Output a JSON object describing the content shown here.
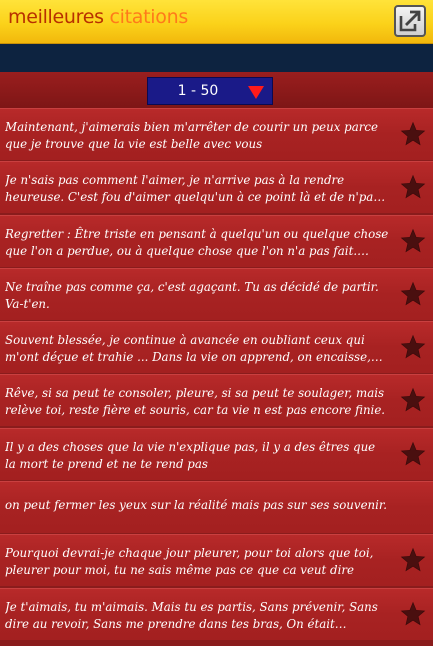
{
  "app": {
    "title_part1": "meilleures",
    "title_part2": "citations",
    "share_icon": "share-external-icon"
  },
  "pager": {
    "range": "1 - 50",
    "dropdown_icon": "triangle-down-icon"
  },
  "colors": {
    "titlebar": "#fbd21a",
    "nav_band": "#0d2340",
    "row": "#a82222",
    "pager": "#1a1a88",
    "star": "#4a0f0f"
  },
  "quotes": [
    {
      "text": "Maintenant, j'aimerais bien m'arrêter de courir un peux parce que je trouve que la vie est belle avec vous"
    },
    {
      "text": "Je n'sais pas comment l'aimer, je n'arrive pas à la rendre heureuse. C'est fou d'aimer quelqu'un à ce point là et de n'pas savoir le lui..."
    },
    {
      "text": "Regretter : Être triste en pensant à quelqu'un ou quelque chose que l'on a perdue, ou à quelque chose que l'on n'a pas fait. Synonyme ..."
    },
    {
      "text": "Ne traîne pas comme ça, c'est agaçant. Tu as décidé de partir. Va-t'en."
    },
    {
      "text": "Souvent blessée, je continue à avancée en oubliant ceux qui m'ont déçue et trahie ... Dans la vie on apprend, on encaisse, on fait des..."
    },
    {
      "text": "Rêve, si sa peut te consoler, pleure, si sa peut te soulager, mais relève toi, reste fière et souris, car ta vie n est pas encore finie."
    },
    {
      "text": "Il y a des choses que la vie n'explique pas, il y a des êtres que la mort te prend et ne te rend pas"
    },
    {
      "text": "on peut fermer les yeux sur la réalité mais pas sur ses souvenir."
    },
    {
      "text": "Pourquoi devrai-je chaque jour pleurer, pour toi alors que toi, pleurer pour moi, tu ne sais même pas ce que ca veut dire"
    },
    {
      "text": "Je t'aimais, tu m'aimais. Mais tu es partis, Sans prévenir, Sans dire au revoir, Sans me prendre dans tes bras, On était pourtant si..."
    }
  ]
}
